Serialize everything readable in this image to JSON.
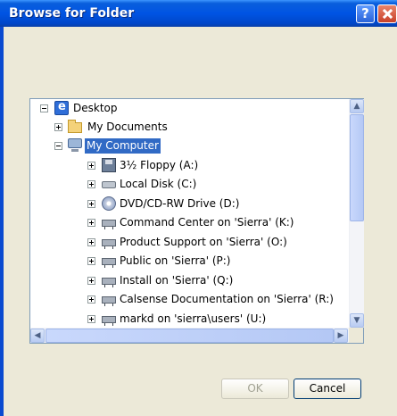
{
  "window": {
    "title": "Browse for Folder",
    "help_label": "?",
    "title_bar_color": "#0054e3"
  },
  "tree": {
    "items": [
      {
        "label": "Desktop",
        "icon": "desktop-icon",
        "expander": "minus",
        "selected": false
      },
      {
        "label": "My Documents",
        "icon": "folder-icon",
        "expander": "plus",
        "selected": false
      },
      {
        "label": "My Computer",
        "icon": "computer-icon",
        "expander": "minus",
        "selected": true
      },
      {
        "label": "3½ Floppy (A:)",
        "icon": "floppy-icon",
        "expander": "plus",
        "selected": false
      },
      {
        "label": "Local Disk (C:)",
        "icon": "hard-disk-icon",
        "expander": "plus",
        "selected": false
      },
      {
        "label": "DVD/CD-RW Drive (D:)",
        "icon": "dvd-drive-icon",
        "expander": "plus",
        "selected": false
      },
      {
        "label": "Command Center on 'Sierra' (K:)",
        "icon": "network-drive-icon",
        "expander": "plus",
        "selected": false
      },
      {
        "label": "Product Support on 'Sierra' (O:)",
        "icon": "network-drive-icon",
        "expander": "plus",
        "selected": false
      },
      {
        "label": "Public on 'Sierra' (P:)",
        "icon": "network-drive-icon",
        "expander": "plus",
        "selected": false
      },
      {
        "label": "Install on 'Sierra' (Q:)",
        "icon": "network-drive-icon",
        "expander": "plus",
        "selected": false
      },
      {
        "label": "Calsense Documentation on 'Sierra' (R:)",
        "icon": "network-drive-icon",
        "expander": "plus",
        "selected": false
      },
      {
        "label": "markd on 'sierra\\users' (U:)",
        "icon": "network-drive-icon",
        "expander": "plus",
        "selected": false
      }
    ],
    "selection_color": "#316ac5"
  },
  "buttons": {
    "ok_label": "OK",
    "cancel_label": "Cancel"
  }
}
